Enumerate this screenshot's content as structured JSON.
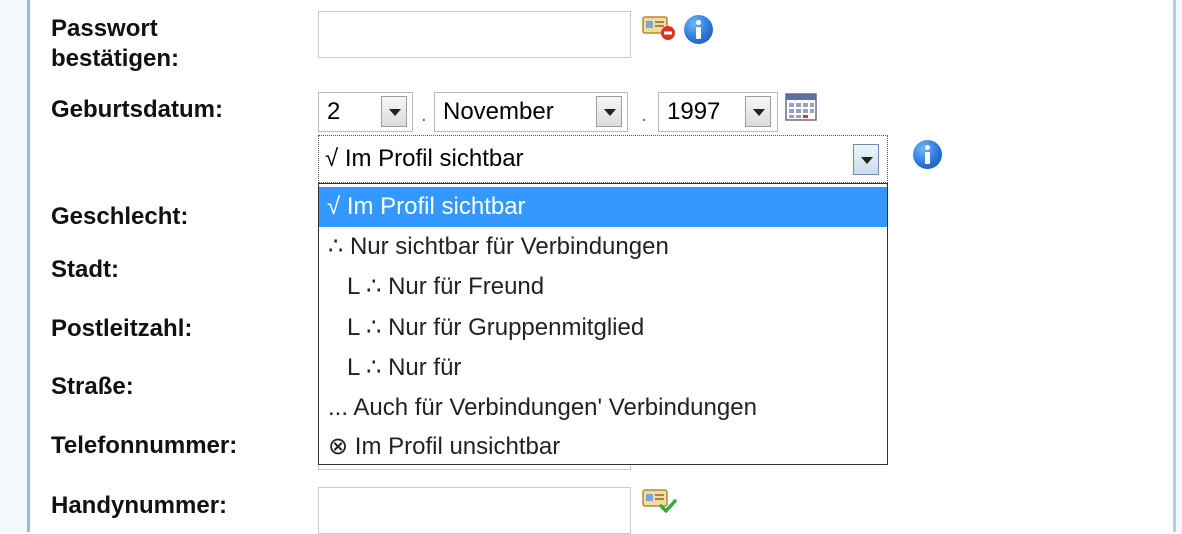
{
  "form": {
    "labels": {
      "password_confirm_line1": "Passwort",
      "password_confirm_line2": "bestätigen:",
      "birthdate": "Geburtsdatum:",
      "gender": "Geschlecht:",
      "city": "Stadt:",
      "postal_code": "Postleitzahl:",
      "street": "Straße:",
      "phone": "Telefonnummer:",
      "mobile": "Handynummer:"
    },
    "password_confirm_value": "",
    "mobile_value": ""
  },
  "birthdate": {
    "day": "2",
    "month": "November",
    "year": "1997",
    "separator": "."
  },
  "visibility": {
    "selected": "√ Im Profil sichtbar",
    "options": [
      "√ Im Profil sichtbar",
      "∴ Nur sichtbar für Verbindungen",
      "L ∴ Nur für Freund",
      "L ∴ Nur für Gruppenmitglied",
      "L ∴ Nur für",
      "... Auch für Verbindungen' Verbindungen",
      "⊗ Im Profil unsichtbar"
    ]
  },
  "icons": {
    "password_status": "card-remove-icon",
    "info": "info-icon",
    "calendar": "calendar-icon",
    "mobile_status": "card-check-icon"
  },
  "colors": {
    "selected_option_bg": "#3399ff",
    "info_blue": "#2a78d6",
    "frame_border": "#9fb7d0"
  }
}
